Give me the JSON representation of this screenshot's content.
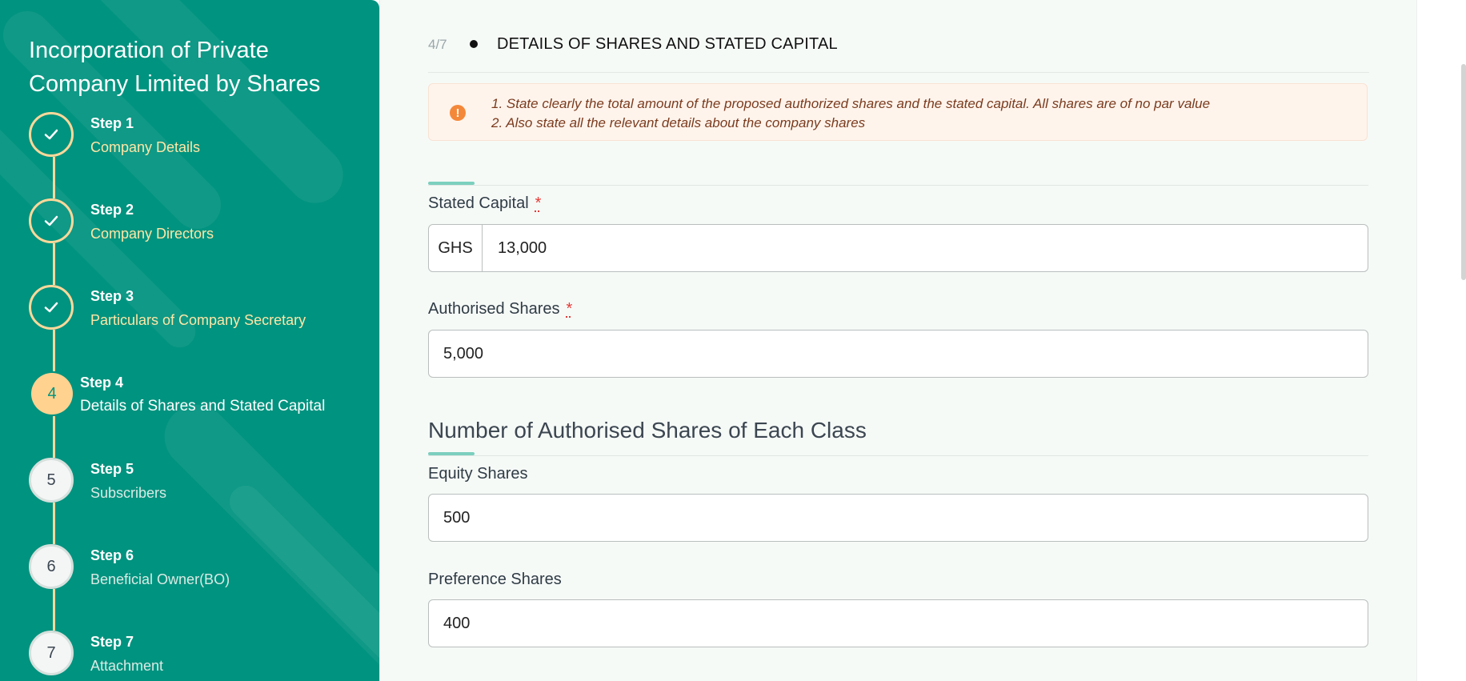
{
  "sidebar": {
    "title_line1": "Incorporation of Private",
    "title_line2": "Company Limited by Shares",
    "steps": [
      {
        "label": "Step 1",
        "name": "Company Details",
        "status": "done",
        "marker": ""
      },
      {
        "label": "Step 2",
        "name": "Company Directors",
        "status": "done",
        "marker": ""
      },
      {
        "label": "Step 3",
        "name": "Particulars of Company Secretary",
        "status": "done",
        "marker": ""
      },
      {
        "label": "Step 4",
        "name": "Details of Shares and Stated Capital",
        "status": "current",
        "marker": "4"
      },
      {
        "label": "Step 5",
        "name": "Subscribers",
        "status": "pending",
        "marker": "5"
      },
      {
        "label": "Step 6",
        "name": "Beneficial Owner(BO)",
        "status": "pending",
        "marker": "6"
      },
      {
        "label": "Step 7",
        "name": "Attachment",
        "status": "pending",
        "marker": "7"
      }
    ]
  },
  "header": {
    "progress": "4/7",
    "title": "DETAILS OF SHARES AND STATED CAPITAL"
  },
  "alert": {
    "icon": "exclamation-circle-icon",
    "line1": "1. State clearly the total amount of the proposed authorized shares and the stated capital. All shares are of no par value",
    "line2": "2. Also state all the relevant details about the company shares"
  },
  "form": {
    "stated_capital": {
      "label": "Stated Capital",
      "required_mark": "*",
      "prefix": "GHS",
      "value": "13,000"
    },
    "authorised_shares": {
      "label": "Authorised Shares",
      "required_mark": "*",
      "value": "5,000"
    },
    "class_heading": "Number of Authorised Shares of Each Class",
    "equity_shares": {
      "label": "Equity Shares",
      "value": "500"
    },
    "preference_shares": {
      "label": "Preference Shares",
      "value": "400"
    }
  },
  "colors": {
    "sidebar_bg": "#00937f",
    "step_done": "#ffd89a",
    "step_current": "#ffd28f",
    "accent": "#7ccfbe",
    "required": "#e53935",
    "alert_bg": "#fff4ec",
    "alert_icon": "#f4883a"
  }
}
